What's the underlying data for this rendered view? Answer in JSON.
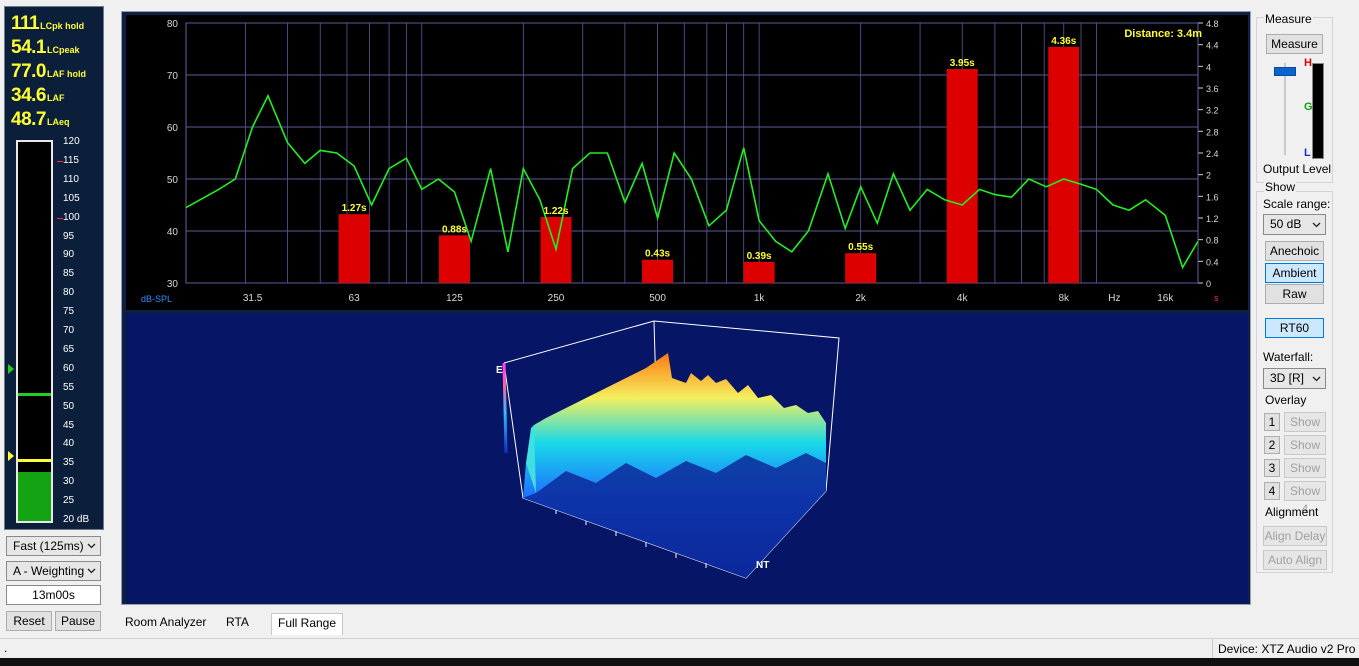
{
  "readings": [
    {
      "value": "111",
      "label": "LCpk hold"
    },
    {
      "value": "54.1",
      "label": "LCpeak"
    },
    {
      "value": "77.0",
      "label": "LAF hold"
    },
    {
      "value": "34.6",
      "label": "LAF"
    },
    {
      "value": "48.7",
      "label": "LAeq"
    }
  ],
  "meter_scale": [
    "120",
    "115",
    "110",
    "105",
    "100",
    "95",
    "90",
    "85",
    "80",
    "75",
    "70",
    "65",
    "60",
    "55",
    "50",
    "45",
    "40",
    "35",
    "30",
    "25",
    "20 dB"
  ],
  "meter_levels": {
    "fill_db": 33,
    "green_line_db": 53,
    "yellow_line_db": 35.5,
    "green_marker_db": 60,
    "yellow_marker_db": 37
  },
  "meter_controls": {
    "speed": "Fast (125ms)",
    "weighting": "A - Weighting",
    "elapsed": "13m00s",
    "reset": "Reset",
    "pause": "Pause"
  },
  "chart_data": {
    "type": "bar",
    "ylabel": "dB-SPL",
    "y_ticks": [
      "80",
      "70",
      "60",
      "50",
      "40",
      "30"
    ],
    "ylim": [
      30,
      80
    ],
    "y2_ticks": [
      "4.8",
      "4.4",
      "4",
      "3.6",
      "3.2",
      "2.8",
      "2.4",
      "2",
      "1.6",
      "1.2",
      "0.8",
      "0.4",
      "0"
    ],
    "y2_unit": "s",
    "x_ticks": [
      "31.5",
      "63",
      "125",
      "250",
      "500",
      "1k",
      "2k",
      "4k",
      "8k",
      "16k"
    ],
    "x_unit": "Hz",
    "annotation": "Distance: 3.4m",
    "rt60_bars": [
      {
        "band": "63",
        "value": 1.27,
        "label": "1.27s"
      },
      {
        "band": "125",
        "value": 0.88,
        "label": "0.88s"
      },
      {
        "band": "250",
        "value": 1.22,
        "label": "1.22s"
      },
      {
        "band": "500",
        "value": 0.43,
        "label": "0.43s"
      },
      {
        "band": "1k",
        "value": 0.39,
        "label": "0.39s"
      },
      {
        "band": "2k",
        "value": 0.55,
        "label": "0.55s"
      },
      {
        "band": "4k",
        "value": 3.95,
        "label": "3.95s"
      },
      {
        "band": "8k",
        "value": 4.36,
        "label": "4.36s"
      }
    ],
    "spl_curve": {
      "x_hz": [
        20,
        22,
        25,
        28,
        31.5,
        35,
        40,
        45,
        50,
        56,
        63,
        71,
        80,
        90,
        100,
        112,
        125,
        140,
        160,
        180,
        200,
        224,
        250,
        280,
        315,
        355,
        400,
        450,
        500,
        560,
        630,
        710,
        800,
        900,
        1000,
        1120,
        1250,
        1400,
        1600,
        1800,
        2000,
        2240,
        2500,
        2800,
        3150,
        3550,
        4000,
        4500,
        5000,
        5600,
        6300,
        7100,
        8000,
        9000,
        10000,
        11200,
        12500,
        14000,
        16000,
        18000,
        20000
      ],
      "y_db": [
        44.5,
        46,
        48,
        50,
        60,
        66,
        57,
        53,
        55.5,
        55,
        52.5,
        45,
        52,
        54,
        48,
        50,
        47.5,
        38,
        52,
        36,
        52,
        46,
        36.5,
        52,
        55,
        55,
        45.5,
        53,
        42.5,
        55,
        50,
        41,
        44,
        56,
        42,
        38,
        36,
        40,
        51,
        40.5,
        48.5,
        41.5,
        51,
        44,
        48,
        46,
        45,
        48,
        47,
        46.5,
        50,
        48.5,
        50,
        49,
        48,
        45,
        44,
        46,
        43,
        33,
        38
      ]
    }
  },
  "waterfall": {
    "axis_e": "E",
    "axis_nt": "NT"
  },
  "right_panel": {
    "measure_group": "Measure",
    "measure_button": "Measure",
    "output_level": "Output Level",
    "meter_labels": {
      "h": "H",
      "g": "G",
      "l": "L"
    },
    "show_group": "Show",
    "scale_range_label": "Scale range:",
    "scale_range": "50 dB",
    "anechoic": "Anechoic",
    "ambient": "Ambient",
    "raw": "Raw",
    "rt60": "RT60",
    "waterfall_label": "Waterfall:",
    "waterfall_mode": "3D [R]",
    "overlay_group": "Overlay",
    "overlays": [
      {
        "num": "1",
        "label": "Show 1"
      },
      {
        "num": "2",
        "label": "Show 2"
      },
      {
        "num": "3",
        "label": "Show 3"
      },
      {
        "num": "4",
        "label": "Show 4"
      }
    ],
    "alignment_group": "Alignment",
    "align_delay": "Align Delay",
    "auto_align": "Auto Align"
  },
  "tabs": [
    "Room Analyzer",
    "RTA",
    "Full Range"
  ],
  "status": {
    "device": "Device: XTZ Audio v2 Pro",
    "left_mark": "."
  },
  "colors": {
    "curve": "#22ee22",
    "bar": "#dd0000",
    "bar_label": "#ffff33",
    "grid": "#5a5a9a"
  }
}
